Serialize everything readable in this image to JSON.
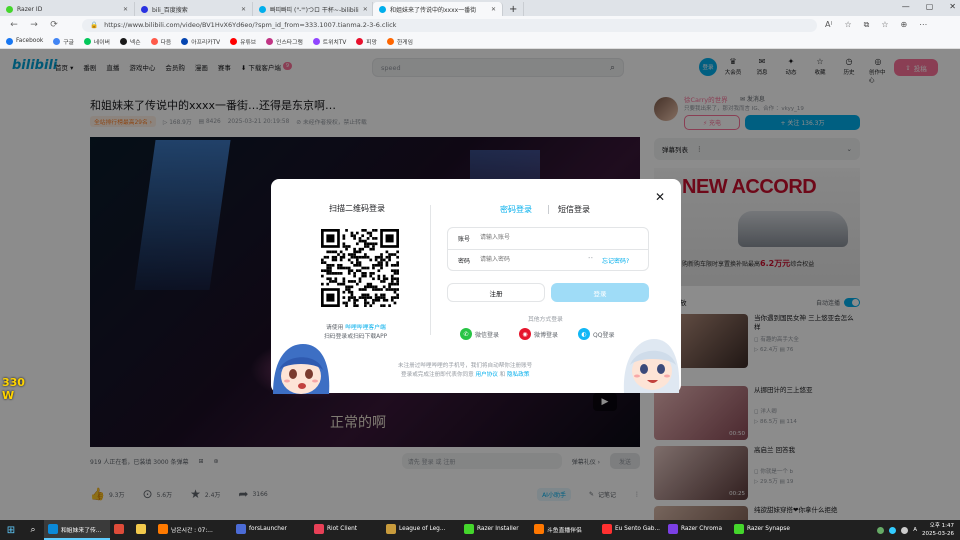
{
  "browser": {
    "tabs": [
      {
        "label": "Razer ID",
        "color": "#44d62c"
      },
      {
        "label": "bili_百度搜索",
        "color": "#2932e1"
      },
      {
        "label": "빠띠빠띠 (\"-\"')つロ 干杯~-bilibili",
        "color": "#00aeec"
      },
      {
        "label": "和姐妹来了传说中的xxxx一番街",
        "color": "#00aeec",
        "active": true
      }
    ],
    "url": "https://www.bilibili.com/video/BV1HvX6Yd6eo/?spm_id_from=333.1007.tianma.2-3-6.click",
    "window_controls": [
      "—",
      "▢",
      "✕"
    ],
    "nav": {
      "back": "←",
      "forward": "→",
      "reload": "⟳"
    },
    "toolbar_icons": [
      "A⁾",
      "☆",
      "⧉",
      "☆",
      "⊕",
      "⋯"
    ],
    "bookmarks": [
      {
        "label": "Facebook",
        "color": "#1877f2"
      },
      {
        "label": "구글",
        "color": "#4285f4"
      },
      {
        "label": "네이버",
        "color": "#03c75a"
      },
      {
        "label": "넥슨",
        "color": "#1a1a1a"
      },
      {
        "label": "다음",
        "color": "#ff5a4a"
      },
      {
        "label": "아프리카TV",
        "color": "#0545b1"
      },
      {
        "label": "유튜브",
        "color": "#ff0000"
      },
      {
        "label": "인스타그램",
        "color": "#c13584"
      },
      {
        "label": "트위치TV",
        "color": "#9146ff"
      },
      {
        "label": "피망",
        "color": "#e8102d"
      },
      {
        "label": "한게임",
        "color": "#ff6600"
      }
    ]
  },
  "header": {
    "logo": "bilibili",
    "nav": [
      "首页 ▾",
      "番剧",
      "直播",
      "游戏中心",
      "会员购",
      "漫画",
      "赛事",
      "⬇ 下载客户端"
    ],
    "nav_badge": "9",
    "search_placeholder": "speed",
    "search_icon": "⌕",
    "login_avatar": "登录",
    "right_nav": [
      {
        "icon": "♛",
        "label": "大会员"
      },
      {
        "icon": "✉",
        "label": "消息"
      },
      {
        "icon": "✦",
        "label": "动态"
      },
      {
        "icon": "☆",
        "label": "收藏"
      },
      {
        "icon": "◷",
        "label": "历史"
      },
      {
        "icon": "◎",
        "label": "创作中心"
      }
    ],
    "upload": "投稿",
    "upload_icon": "⇪"
  },
  "video": {
    "title": "和姐妹来了传说中的xxxx一番街…还得是东京啊…",
    "rank": "全站排行榜最高29名 ›",
    "meta": [
      "▷ 168.9万",
      "▤ 8426",
      "2025-03-21 20:19:58",
      "⊘ 未经作者授权，禁止转载"
    ],
    "subtitle": "正常的啊",
    "play_icon": "▶",
    "danmaku_info": "919 人正在看，已装填 3000 条弹幕",
    "danmaku_icons": [
      "⊞",
      "⊛"
    ],
    "danmaku_login": "请先 登录 或 注册",
    "danmaku_etiquette": "弹幕礼仪 ›",
    "danmaku_send": "发送",
    "actions": [
      {
        "icon": "👍",
        "label": "9.3万"
      },
      {
        "icon": "⊙",
        "label": "5.6万"
      },
      {
        "icon": "★",
        "label": "2.4万"
      },
      {
        "icon": "➦",
        "label": "3166"
      }
    ],
    "ai_button": "AI小助手",
    "notes": "记笔记",
    "notes_icon": "✎",
    "more_icon": "⋮"
  },
  "sidebar": {
    "up_name": "徐Carry的世界",
    "up_message": "✉ 发消息",
    "up_desc": "只要我出来了，那对我而言  IG、合作 ：vkyy_19",
    "charge": "⚡ 充电",
    "follow": "+ 关注 136.3万",
    "danmaku_list": "弹幕列表",
    "danmaku_list_more": "⋮",
    "danmaku_list_chevron": "⌄",
    "ad": {
      "headline": "NEW ACCORD",
      "text": "购新购车限时享置换补贴最高",
      "highlight": "6.2万元",
      "suffix": "综合权益"
    },
    "autoplay_label": "接下来播放",
    "autoplay_toggle": "自动连播",
    "recommendations": [
      {
        "title": "当你遇到国民女神 三上悠亚会怎么样",
        "up": "◻ 有趣的高手大全",
        "stats": "▷ 62.4万  ▤ 76",
        "duration": "",
        "colors": [
          "#c79e8a",
          "#3b2a26"
        ]
      },
      {
        "title": "从挪田计的三上悠亚",
        "up": "◻ 洋人卿",
        "stats": "▷ 86.5万  ▤ 114",
        "duration": "00:50",
        "colors": [
          "#eab7b7",
          "#8a4b57"
        ]
      },
      {
        "title": "高启兰 回答我",
        "up": "◻ 你就是一个 b",
        "stats": "▷ 29.5万  ▤ 19",
        "duration": "00:25",
        "colors": [
          "#e5c8c3",
          "#5b3a3a"
        ]
      },
      {
        "title": "纯欲甜妹穿搭❤你拿什么拒绝",
        "up": "",
        "stats": "",
        "duration": "",
        "colors": [
          "#d8b9a9",
          "#6b4a3f"
        ]
      }
    ]
  },
  "modal": {
    "qr_title": "扫描二维码登录",
    "qr_hint_prefix": "请使用 ",
    "qr_hint_link": "哔哩哔哩客户端",
    "qr_hint_line2": "扫码登录或扫码下载APP",
    "tab_password": "密码登录",
    "tab_sms": "短信登录",
    "account_label": "账号",
    "account_placeholder": "请输入账号",
    "password_label": "密码",
    "password_placeholder": "请输入密码",
    "eye_icon": "⁃⁃",
    "forgot": "忘记密码?",
    "register": "注册",
    "login": "登录",
    "other_methods": "其他方式登录",
    "social": [
      {
        "label": "微信登录",
        "icon": "✆",
        "color": "#28c445"
      },
      {
        "label": "微博登录",
        "icon": "◉",
        "color": "#e6162d"
      },
      {
        "label": "QQ登录",
        "icon": "◐",
        "color": "#12b7f5"
      }
    ],
    "terms_line1": "未注册过哔哩哔哩的手机号，我们将自动帮你注册账号",
    "terms_line2_prefix": "登录或完成注册即代表你同意 ",
    "terms_link1": "用户协议",
    "terms_mid": " 和 ",
    "terms_link2": "隐私政策",
    "close_icon": "✕"
  },
  "side_overlay": {
    "line1": "330",
    "line2": "W"
  },
  "taskbar": {
    "start_icon": "⊞",
    "search_icon": "⌕",
    "apps": [
      {
        "label": "和姐妹来了传…",
        "color": "#0b8ad9",
        "active": true
      },
      {
        "label": "",
        "color": "#dd4b39"
      },
      {
        "label": "",
        "color": "#f2c94c"
      },
      {
        "label": "남은시간 : 07:...",
        "color": "#ff7a00"
      },
      {
        "label": "forsLauncher",
        "color": "#4b6bd6"
      },
      {
        "label": "Riot Client",
        "color": "#e84057"
      },
      {
        "label": "League of Leg...",
        "color": "#c89b3c"
      },
      {
        "label": "Razer Installer",
        "color": "#44d62c"
      },
      {
        "label": "斗鱼直播伴侣",
        "color": "#ff7700"
      },
      {
        "label": "Eu Sento Gab...",
        "color": "#ff3030"
      },
      {
        "label": "Razer Chroma",
        "color": "#7b3fe4"
      },
      {
        "label": "Razer Synapse",
        "color": "#44d62c"
      }
    ],
    "time": "오후 1:47",
    "date": "2025-03-26",
    "lang": "A"
  }
}
